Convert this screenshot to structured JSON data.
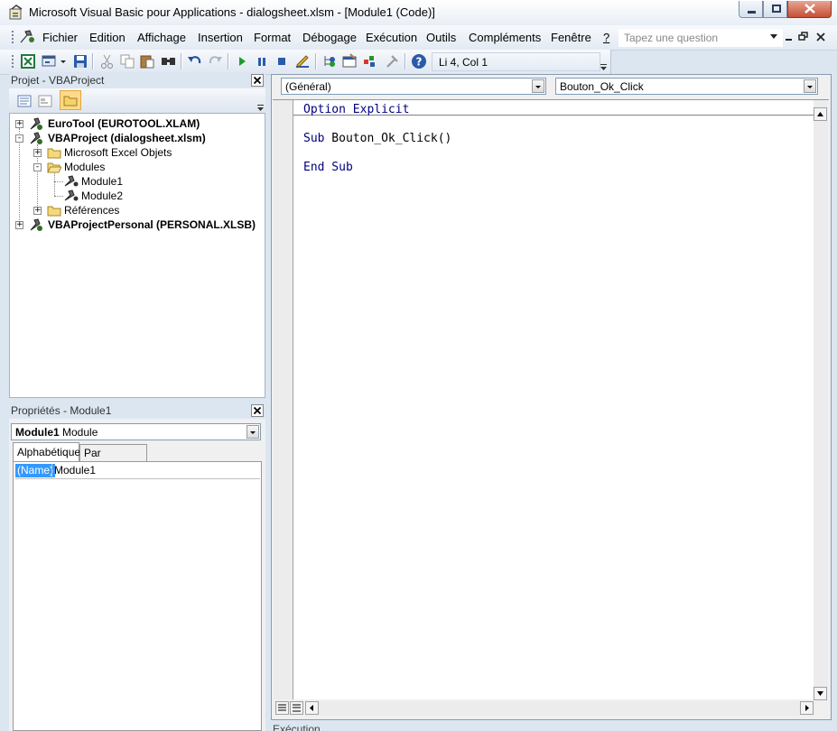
{
  "window": {
    "title": "Microsoft Visual Basic pour Applications - dialogsheet.xlsm - [Module1 (Code)]"
  },
  "menu": {
    "items": [
      {
        "label": "Fichier"
      },
      {
        "label": "Edition"
      },
      {
        "label": "Affichage"
      },
      {
        "label": "Insertion"
      },
      {
        "label": "Format"
      },
      {
        "label": "Débogage"
      },
      {
        "label": "Exécution"
      },
      {
        "label": "Outils"
      },
      {
        "label": "Compléments"
      },
      {
        "label": "Fenêtre"
      },
      {
        "label": "?"
      }
    ],
    "question_placeholder": "Tapez une question"
  },
  "toolbar": {
    "icons": [
      "excel-view-icon",
      "insert-userform-icon",
      "save-icon",
      "cut-icon",
      "copy-icon",
      "paste-icon",
      "find-icon",
      "undo-icon",
      "redo-icon",
      "run-icon",
      "break-icon",
      "reset-icon",
      "design-mode-icon",
      "project-explorer-icon",
      "properties-window-icon",
      "object-browser-icon",
      "toolbox-icon",
      "help-icon"
    ],
    "position": "Li 4, Col 1"
  },
  "project_pane": {
    "title": "Projet - VBAProject",
    "tree": [
      {
        "label": "EuroTool (EUROTOOL.XLAM)",
        "bold": true,
        "expander": "+"
      },
      {
        "label": "VBAProject (dialogsheet.xlsm)",
        "bold": true,
        "expander": "-"
      },
      {
        "label": "Microsoft Excel Objets",
        "bold": false,
        "expander": "+"
      },
      {
        "label": "Modules",
        "bold": false,
        "expander": "-"
      },
      {
        "label": "Module1",
        "bold": false,
        "expander": ""
      },
      {
        "label": "Module2",
        "bold": false,
        "expander": ""
      },
      {
        "label": "Références",
        "bold": false,
        "expander": "+"
      },
      {
        "label": "VBAProjectPersonal (PERSONAL.XLSB)",
        "bold": true,
        "expander": "+"
      }
    ]
  },
  "properties_pane": {
    "title": "Propriétés - Module1",
    "object_name": "Module1",
    "object_type": "Module",
    "tabs": [
      {
        "label": "Alphabétique"
      },
      {
        "label": "Par catégorie"
      }
    ],
    "rows": [
      {
        "name": "(Name)",
        "value": "Module1"
      }
    ]
  },
  "code_window": {
    "object_combo": "(Général)",
    "procedure_combo": "Bouton_Ok_Click",
    "lines": [
      {
        "keyword": "Option Explicit",
        "rest": ""
      },
      {
        "keyword": "Sub",
        "rest": " Bouton_Ok_Click()"
      },
      {
        "keyword": "End Sub",
        "rest": ""
      }
    ]
  },
  "bottom_pane": {
    "title": "Exécution"
  }
}
